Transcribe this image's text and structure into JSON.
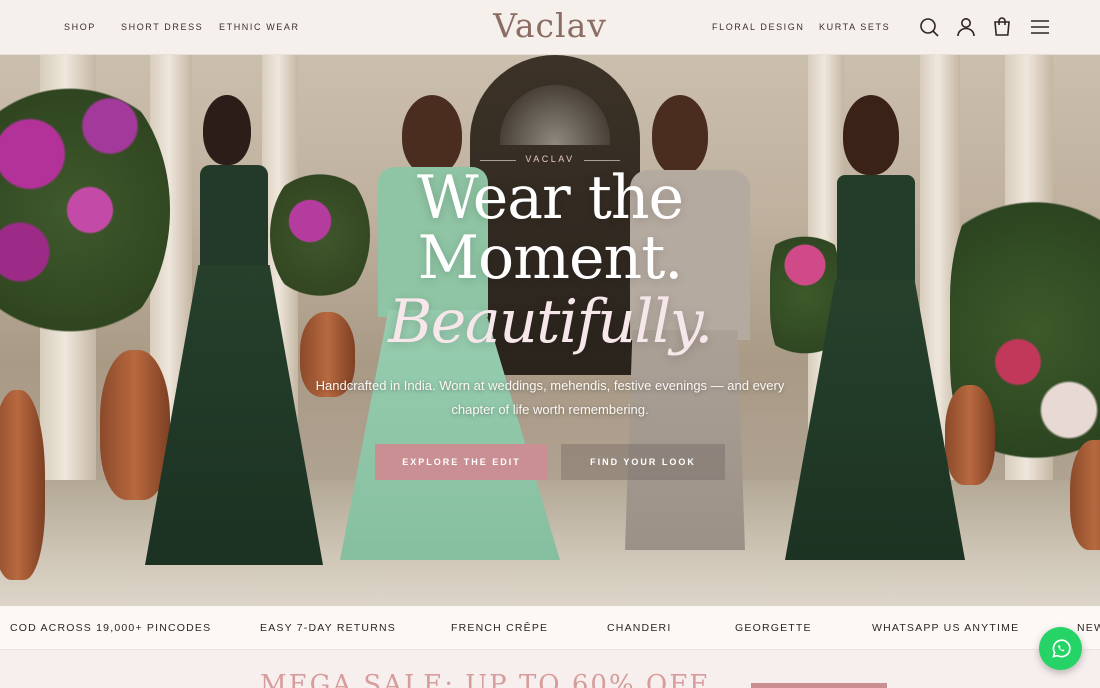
{
  "header": {
    "logo": "Vaclav",
    "nav_left": [
      "SHOP",
      "SHORT DRESS",
      "ETHNIC WEAR"
    ],
    "nav_right": [
      "FLORAL DESIGN",
      "KURTA SETS"
    ],
    "icons": [
      "search-icon",
      "account-icon",
      "cart-icon",
      "menu-icon"
    ]
  },
  "hero": {
    "eyebrow": "VACLAV",
    "headline_line1": "Wear the",
    "headline_line2": "Moment.",
    "headline_italic": "Beautifully.",
    "subtext": "Handcrafted in India. Worn at weddings, mehendis, festive evenings — and every chapter of life worth remembering.",
    "primary_cta": "EXPLORE THE EDIT",
    "secondary_cta": "FIND YOUR LOOK"
  },
  "ticker": {
    "items": [
      "COD ACROSS 19,000+ PINCODES",
      "EASY 7-DAY RETURNS",
      "FRENCH CRÊPE",
      "CHANDERI",
      "GEORGETTE",
      "WHATSAPP US ANYTIME",
      "NEW"
    ]
  },
  "sale": {
    "text": "MEGA SALE: UP TO 60% OFF"
  },
  "colors": {
    "accent_pink": "#c98f93",
    "logo": "#8b6d64",
    "whatsapp_green": "#25d366"
  }
}
